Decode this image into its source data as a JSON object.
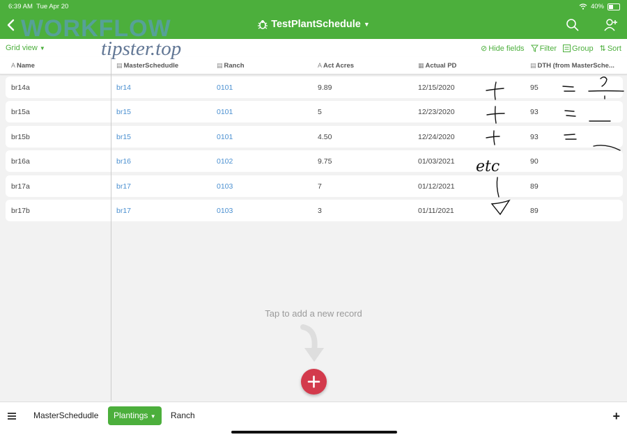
{
  "status_bar": {
    "time": "6:39 AM",
    "date": "Tue Apr 20",
    "battery": "40%"
  },
  "navbar": {
    "title": "TestPlantSchedule",
    "back_icon": "chevron-left-icon",
    "search_icon": "search-icon",
    "users_icon": "users-icon",
    "base_icon": "bug-icon"
  },
  "watermark": {
    "line1": "WORKFLOW",
    "line2": "tipster.top"
  },
  "toolbar": {
    "grid_view": "Grid view",
    "hide_fields": "Hide fields",
    "filter": "Filter",
    "group": "Group",
    "sort": "Sort"
  },
  "columns": [
    "Name",
    "MasterSchedudle",
    "Ranch",
    "Act Acres",
    "Actual PD",
    "DTH (from MasterSche..."
  ],
  "rows": [
    {
      "name": "br14a",
      "master": "br14",
      "ranch": "0101",
      "acres": "9.89",
      "pd": "12/15/2020",
      "dth": "95"
    },
    {
      "name": "br15a",
      "master": "br15",
      "ranch": "0101",
      "acres": "5",
      "pd": "12/23/2020",
      "dth": "93"
    },
    {
      "name": "br15b",
      "master": "br15",
      "ranch": "0101",
      "acres": "4.50",
      "pd": "12/24/2020",
      "dth": "93"
    },
    {
      "name": "br16a",
      "master": "br16",
      "ranch": "0102",
      "acres": "9.75",
      "pd": "01/03/2021",
      "dth": "90"
    },
    {
      "name": "br17a",
      "master": "br17",
      "ranch": "0103",
      "acres": "7",
      "pd": "01/12/2021",
      "dth": "89"
    },
    {
      "name": "br17b",
      "master": "br17",
      "ranch": "0103",
      "acres": "3",
      "pd": "01/11/2021",
      "dth": "89"
    }
  ],
  "handwriting": {
    "etc": "etc",
    "question": "?"
  },
  "empty_hint": "Tap to add a new record",
  "tabs": {
    "master": "MasterSchedudle",
    "plantings": "Plantings",
    "ranch": "Ranch"
  },
  "colors": {
    "accent": "#4caf3c",
    "fab": "#d33a4c",
    "link": "#4a8fd0"
  }
}
